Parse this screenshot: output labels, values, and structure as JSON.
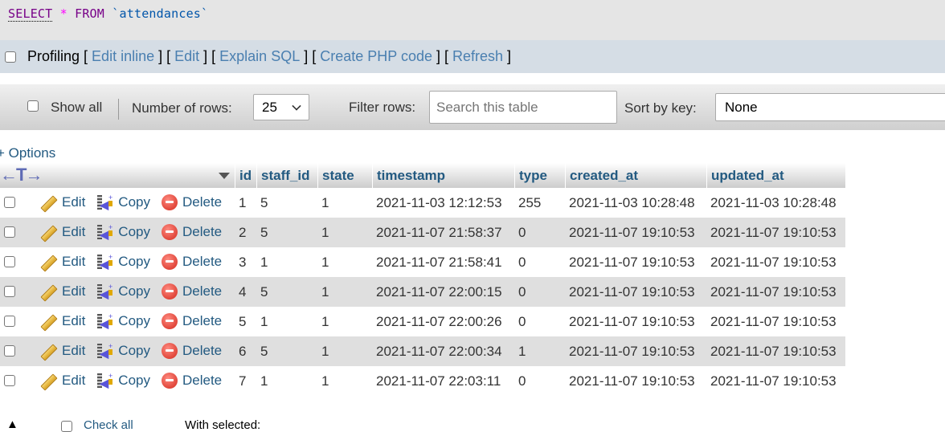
{
  "sql": {
    "keyword_select": "SELECT",
    "operator": "*",
    "keyword_from": "FROM",
    "identifier": "`attendances`"
  },
  "profiling": {
    "label": "Profiling",
    "links": [
      "Edit inline",
      "Edit",
      "Explain SQL",
      "Create PHP code",
      "Refresh"
    ]
  },
  "navigation": {
    "show_all_label": "Show all",
    "rows_label": "Number of rows:",
    "rows_value": "25",
    "filter_label": "Filter rows:",
    "filter_placeholder": "Search this table",
    "sort_label": "Sort by key:",
    "sort_value": "None"
  },
  "options_label": "+ Options",
  "table": {
    "columns": [
      "id",
      "staff_id",
      "state",
      "timestamp",
      "type",
      "created_at",
      "updated_at"
    ],
    "actions": {
      "edit": "Edit",
      "copy": "Copy",
      "delete": "Delete"
    },
    "rows": [
      {
        "id": "1",
        "staff_id": "5",
        "state": "1",
        "timestamp": "2021-11-03 12:12:53",
        "type": "255",
        "created_at": "2021-11-03 10:28:48",
        "updated_at": "2021-11-03 10:28:48"
      },
      {
        "id": "2",
        "staff_id": "5",
        "state": "1",
        "timestamp": "2021-11-07 21:58:37",
        "type": "0",
        "created_at": "2021-11-07 19:10:53",
        "updated_at": "2021-11-07 19:10:53"
      },
      {
        "id": "3",
        "staff_id": "1",
        "state": "1",
        "timestamp": "2021-11-07 21:58:41",
        "type": "0",
        "created_at": "2021-11-07 19:10:53",
        "updated_at": "2021-11-07 19:10:53"
      },
      {
        "id": "4",
        "staff_id": "5",
        "state": "1",
        "timestamp": "2021-11-07 22:00:15",
        "type": "0",
        "created_at": "2021-11-07 19:10:53",
        "updated_at": "2021-11-07 19:10:53"
      },
      {
        "id": "5",
        "staff_id": "1",
        "state": "1",
        "timestamp": "2021-11-07 22:00:26",
        "type": "0",
        "created_at": "2021-11-07 19:10:53",
        "updated_at": "2021-11-07 19:10:53"
      },
      {
        "id": "6",
        "staff_id": "5",
        "state": "1",
        "timestamp": "2021-11-07 22:00:34",
        "type": "1",
        "created_at": "2021-11-07 19:10:53",
        "updated_at": "2021-11-07 19:10:53"
      },
      {
        "id": "7",
        "staff_id": "1",
        "state": "1",
        "timestamp": "2021-11-07 22:03:11",
        "type": "0",
        "created_at": "2021-11-07 19:10:53",
        "updated_at": "2021-11-07 19:10:53"
      }
    ]
  },
  "bulk": {
    "check_all_label": "Check all",
    "with_selected_label": "With selected:"
  },
  "colors": {
    "link": "#235a81",
    "sql_bar_bg": "#e5e5e5",
    "profiling_bg": "#d5dde5",
    "even_row_bg": "#dfdfdf"
  }
}
